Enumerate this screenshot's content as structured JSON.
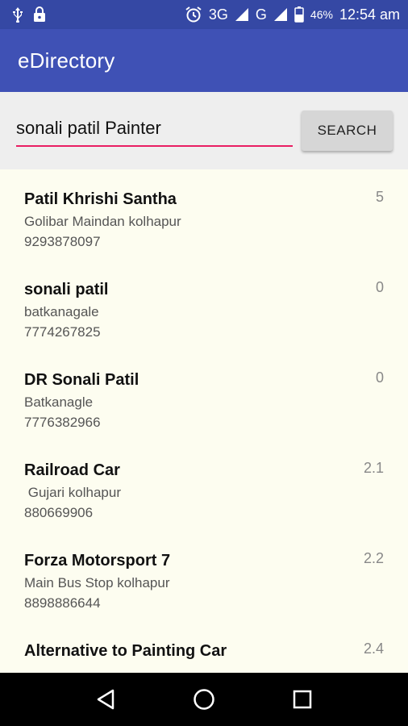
{
  "status_bar": {
    "network_label": "3G",
    "carrier_label": "G",
    "battery_percent": "46%",
    "time": "12:54 am",
    "icons": [
      "usb-icon",
      "lock-icon",
      "alarm-icon",
      "signal-icon",
      "battery-icon"
    ]
  },
  "app_bar": {
    "title": "eDirectory"
  },
  "search": {
    "value": "sonali patil Painter",
    "button_label": "SEARCH",
    "accent_color": "#e91e63"
  },
  "results": [
    {
      "name": "Patil Khrishi Santha",
      "address": "Golibar Maindan kolhapur",
      "phone": "9293878097",
      "rating": "5"
    },
    {
      "name": "sonali patil",
      "address": "batkanagale",
      "phone": "7774267825",
      "rating": "0"
    },
    {
      "name": "DR Sonali Patil",
      "address": "Batkanagle",
      "phone": "7776382966",
      "rating": "0"
    },
    {
      "name": "Railroad Car",
      "address": " Gujari kolhapur",
      "phone": "880669906",
      "rating": "2.1"
    },
    {
      "name": "Forza Motorsport 7",
      "address": "Main Bus Stop kolhapur",
      "phone": "8898886644",
      "rating": "2.2"
    },
    {
      "name": "Alternative to Painting Car",
      "address": "",
      "phone": "",
      "rating": "2.4"
    }
  ],
  "colors": {
    "primary": "#3f51b5",
    "primary_dark": "#3548a4",
    "list_background": "#fdfdf0"
  }
}
